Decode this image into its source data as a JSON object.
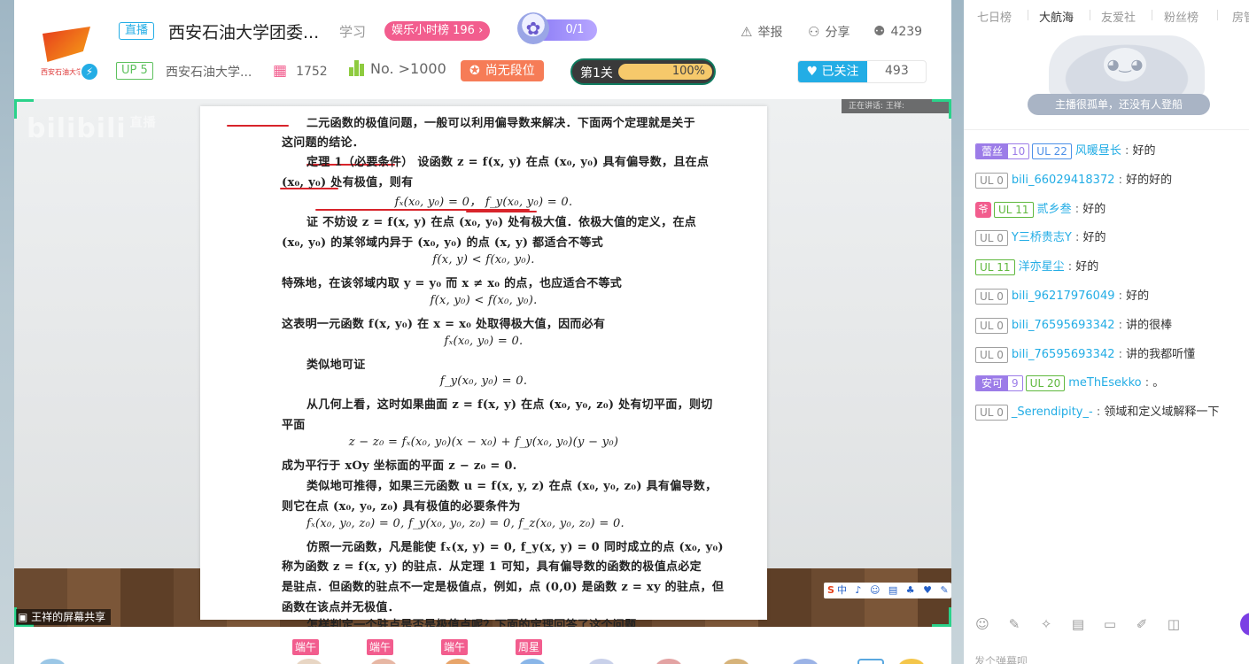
{
  "header": {
    "live_badge": "直播",
    "room_title": "西安石油大学团委...",
    "area": "学习",
    "rank_pill": "娱乐小时榜 196",
    "rank_arrow": "›",
    "mascot_count": "0/1",
    "logo_text": "西安石油大学",
    "actions": {
      "report": "举报",
      "share": "分享",
      "viewers": "4239"
    },
    "up_level": "UP 5",
    "anchor_name": "西安石油大学...",
    "gift_count": "1752",
    "no_rank": "No. >1000",
    "segment": "尚无段位",
    "level": {
      "label": "第1关",
      "percent_text": "100%",
      "fraction": 1.0
    },
    "follow": {
      "label": "已关注",
      "count": "493"
    }
  },
  "player": {
    "watermark": "bilibili",
    "watermark_sub": "直播",
    "speaking": "正在讲话: 王祥:",
    "screen_share_label": "王祥的屏幕共享",
    "ime": {
      "s": "S",
      "rest": "中 ♪ ☺ ▤ ♣ ♥ ✎"
    }
  },
  "document_lines": [
    "二元函数的极值问题，一般可以利用偏导数来解决．下面两个定理就是关于",
    "这问题的结论．",
    "定理 1（必要条件）  设函数 z = f(x, y) 在点 (x₀, y₀) 具有偏导数，且在点",
    "(x₀, y₀) 处有极值，则有",
    "fₓ(x₀, y₀) = 0，    f_y(x₀, y₀) = 0.",
    "证  不妨设 z = f(x, y) 在点 (x₀, y₀) 处有极大值．依极大值的定义，在点",
    "(x₀, y₀) 的某邻域内异于 (x₀, y₀) 的点 (x, y) 都适合不等式",
    "f(x, y) < f(x₀, y₀).",
    "特殊地，在该邻域内取 y = y₀ 而 x ≠ x₀ 的点，也应适合不等式",
    "f(x, y₀) < f(x₀, y₀).",
    "这表明一元函数 f(x, y₀) 在 x = x₀ 处取得极大值，因而必有",
    "fₓ(x₀, y₀) = 0.",
    "类似地可证",
    "f_y(x₀, y₀) = 0.",
    "从几何上看，这时如果曲面 z = f(x, y) 在点 (x₀, y₀, z₀) 处有切平面，则切",
    "平面",
    "z − z₀ = fₓ(x₀, y₀)(x − x₀) + f_y(x₀, y₀)(y − y₀)",
    "成为平行于 xOy 坐标面的平面 z − z₀ = 0.",
    "类似地可推得，如果三元函数 u = f(x, y, z) 在点 (x₀, y₀, z₀) 具有偏导数，",
    "则它在点 (x₀, y₀, z₀) 具有极值的必要条件为",
    "fₓ(x₀, y₀, z₀) = 0, f_y(x₀, y₀, z₀) = 0, f_z(x₀, y₀, z₀) = 0.",
    "仿照一元函数，凡是能使 fₓ(x, y) = 0, f_y(x, y) = 0 同时成立的点 (x₀, y₀)",
    "称为函数 z = f(x, y) 的驻点．从定理 1 可知，具有偏导数的函数的极值点必定",
    "是驻点．但函数的驻点不一定是极值点，例如，点 (0,0) 是函数 z = xy 的驻点，但",
    "函数在该点并无极值．",
    "怎样判定一个驻点是否是极值点呢？下面的定理回答了这个问题．"
  ],
  "bottombar": {
    "tags": [
      "端午",
      "端午",
      "端午",
      "周星"
    ]
  },
  "sidebar": {
    "tabs": [
      "七日榜",
      "大航海",
      "友爱社",
      "粉丝榜",
      "房管"
    ],
    "empty_text": "主播很孤单，还没有人登船",
    "messages": [
      {
        "medal": {
          "name": "蕾丝",
          "level": "10",
          "color": "#9c7ce8"
        },
        "ul": "UL 22",
        "ul_style": "blue",
        "user": "风暖昼长",
        "text": "好的"
      },
      {
        "ul": "UL 0",
        "ul_style": "g",
        "user": "bili_66029418372",
        "text": "好的好的"
      },
      {
        "guard": "爷",
        "ul": "UL 11",
        "ul_style": "green",
        "user": "贰乡叁",
        "text": "好的"
      },
      {
        "ul": "UL 0",
        "ul_style": "g",
        "user": "Y三桥贵志Y",
        "text": "好的"
      },
      {
        "ul": "UL 11",
        "ul_style": "green",
        "user": "洋亦星尘",
        "text": "好的"
      },
      {
        "ul": "UL 0",
        "ul_style": "g",
        "user": "bili_96217976049",
        "text": "好的"
      },
      {
        "ul": "UL 0",
        "ul_style": "g",
        "user": "bili_76595693342",
        "text": "讲的很棒"
      },
      {
        "ul": "UL 0",
        "ul_style": "g",
        "user": "bili_76595693342",
        "text": "讲的我都听懂"
      },
      {
        "medal": {
          "name": "安可",
          "level": "9",
          "color": "#9c7ce8"
        },
        "ul": "UL 20",
        "ul_style": "green",
        "user": "meThEsekko",
        "text": "。"
      },
      {
        "ul": "UL 0",
        "ul_style": "g",
        "user": "_Serendipity_-",
        "text": "领域和定义域解释一下"
      }
    ],
    "input_hint": "发个弹幕呗"
  }
}
